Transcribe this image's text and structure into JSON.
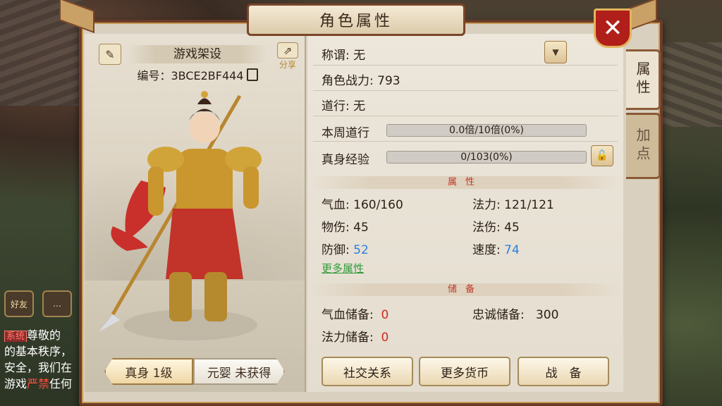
{
  "window": {
    "title": "角色属性",
    "close_icon": "✕"
  },
  "chat": {
    "friend_label": "好友",
    "lines": [
      {
        "tag": "系统",
        "text": "尊敬的"
      },
      {
        "text": "的基本秩序，"
      },
      {
        "text": "安全，我们在"
      },
      {
        "pre": "游戏",
        "red": "严禁",
        "post": "任何"
      }
    ]
  },
  "character": {
    "name": "游戏架设",
    "id_text": "编号：3BCE2BF444",
    "share_label": "分享",
    "tabs": [
      {
        "label": "真身 1级",
        "active": true
      },
      {
        "label": "元婴 未获得",
        "active": false
      }
    ]
  },
  "info": {
    "title_row": "称谓: 无",
    "combat_power": "角色战力: 793",
    "dao": "道行: 无",
    "weekly_dao_label": "本周道行",
    "weekly_dao_bar": "0.0倍/10倍(0%)",
    "weekly_dao_fraction": 0,
    "true_exp_label": "真身经验",
    "true_exp_bar": "0/103(0%)",
    "true_exp_fraction": 0
  },
  "attributes": {
    "section_title": "属性",
    "hp": "气血: 160/160",
    "mp": "法力: 121/121",
    "phys_atk_label": "物伤: ",
    "phys_atk": "45",
    "mag_atk_label": "法伤: ",
    "mag_atk": "45",
    "defense_label": "防御: ",
    "defense": "52",
    "speed_label": "速度: ",
    "speed": "74",
    "more_link": "更多属性"
  },
  "reserves": {
    "section_title": "储备",
    "hp_reserve_label": "气血储备:",
    "hp_reserve": "0",
    "loyalty_reserve_label": "忠诚储备:",
    "loyalty_reserve": "300",
    "mp_reserve_label": "法力储备:",
    "mp_reserve": "0"
  },
  "buttons": {
    "social": "社交关系",
    "currency": "更多货币",
    "equip": "战　备"
  },
  "side_tabs": [
    {
      "label": "属性",
      "active": true
    },
    {
      "label": "加点",
      "active": false
    }
  ],
  "colors": {
    "accent_red": "#b11f1a",
    "value_blue": "#2c7fd9",
    "value_red": "#d12a1e",
    "link_green": "#2f9b3a"
  }
}
